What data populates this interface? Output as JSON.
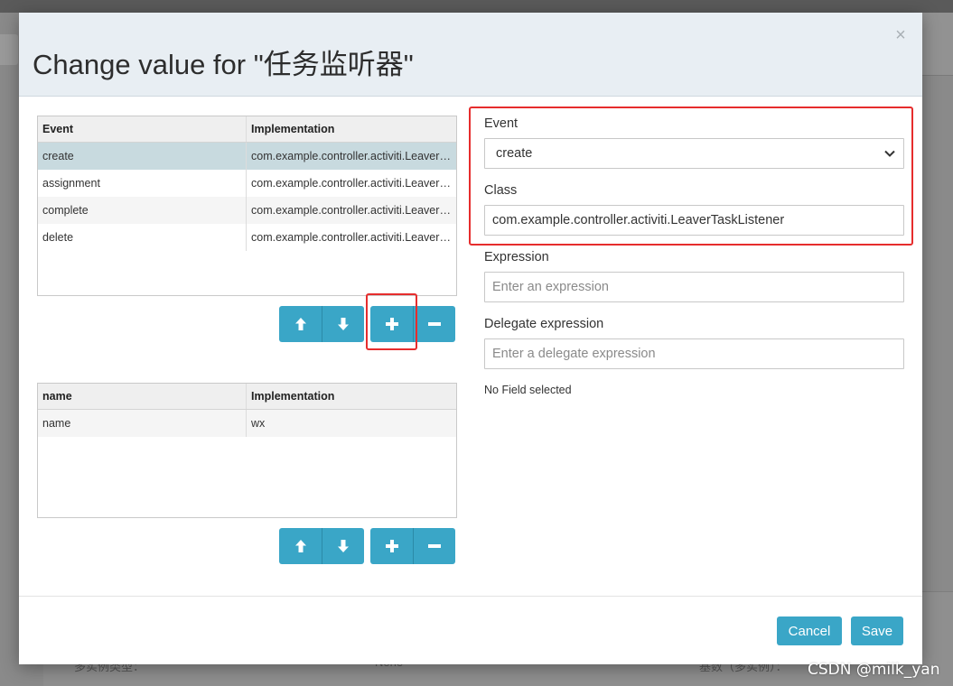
{
  "dialog": {
    "title": "Change value for \"任务监听器\"",
    "close_symbol": "×"
  },
  "listeners_table": {
    "columns": [
      "Event",
      "Implementation"
    ],
    "rows": [
      {
        "event": "create",
        "implementation": "com.example.controller.activiti.LeaverTaskListener",
        "selected": true
      },
      {
        "event": "assignment",
        "implementation": "com.example.controller.activiti.LeaverTaskListener"
      },
      {
        "event": "complete",
        "implementation": "com.example.controller.activiti.LeaverTaskListener"
      },
      {
        "event": "delete",
        "implementation": "com.example.controller.activiti.LeaverTaskListener"
      }
    ]
  },
  "fields_table": {
    "columns": [
      "name",
      "Implementation"
    ],
    "rows": [
      {
        "name": "name",
        "implementation": "wx"
      }
    ]
  },
  "buttons": {
    "move_up_icon": "arrow-up-icon",
    "move_down_icon": "arrow-down-icon",
    "add_icon": "plus-icon",
    "remove_icon": "minus-icon"
  },
  "form": {
    "event_label": "Event",
    "event_value": "create",
    "class_label": "Class",
    "class_value": "com.example.controller.activiti.LeaverTaskListener",
    "expression_label": "Expression",
    "expression_placeholder": "Enter an expression",
    "delegate_label": "Delegate expression",
    "delegate_placeholder": "Enter a delegate expression",
    "no_field_text": "No Field selected"
  },
  "footer": {
    "cancel_label": "Cancel",
    "save_label": "Save"
  },
  "background": {
    "text_1": "多实例类型：",
    "text_2": "None",
    "text_3": "基数（多实例）："
  },
  "watermark": "CSDN @milk_yan",
  "colors": {
    "primary_button": "#3aa6c7",
    "highlight_box": "#e62d2d",
    "selected_row": "#c8dadf",
    "header_bg": "#e8eef3"
  }
}
